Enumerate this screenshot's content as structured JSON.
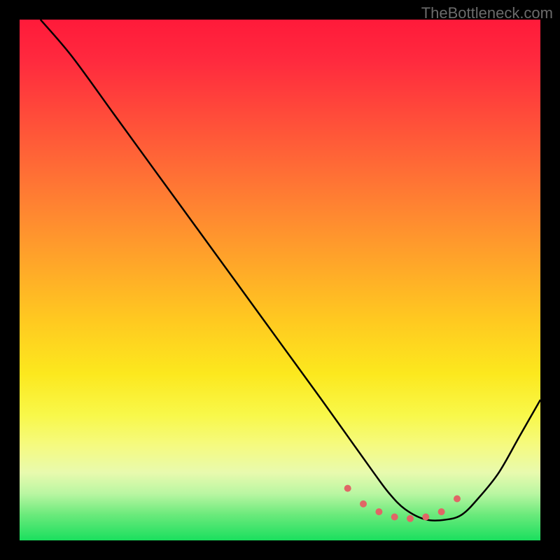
{
  "watermark": "TheBottleneck.com",
  "chart_data": {
    "type": "line",
    "title": "",
    "xlabel": "",
    "ylabel": "",
    "xlim": [
      0,
      100
    ],
    "ylim": [
      0,
      100
    ],
    "series": [
      {
        "name": "bottleneck-curve",
        "x": [
          4,
          10,
          18,
          26,
          34,
          42,
          50,
          58,
          63,
          68,
          71,
          74,
          78,
          82,
          85,
          88,
          92,
          96,
          100
        ],
        "y": [
          100,
          93,
          82,
          71,
          60,
          49,
          38,
          27,
          20,
          13,
          9,
          6,
          4,
          4,
          5,
          8,
          13,
          20,
          27
        ]
      }
    ],
    "markers": {
      "name": "trough-dots",
      "color": "#e06666",
      "x": [
        63,
        66,
        69,
        72,
        75,
        78,
        81,
        84
      ],
      "y": [
        10,
        7,
        5.5,
        4.5,
        4.2,
        4.5,
        5.5,
        8
      ]
    },
    "background_gradient": {
      "top": "#ff1a3a",
      "middle": "#ffca20",
      "bottom": "#1adf5e"
    }
  }
}
